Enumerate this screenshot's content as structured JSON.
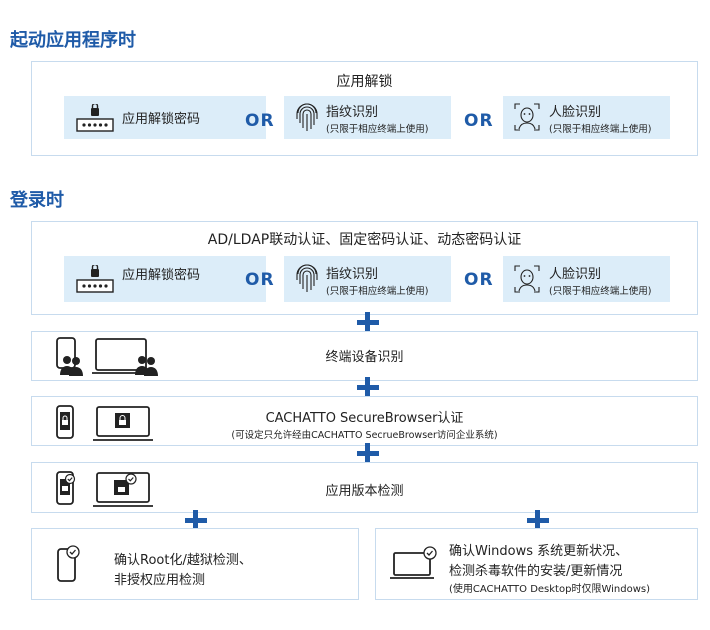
{
  "section1": {
    "heading": "起动应用程序时",
    "panel_title": "应用解锁",
    "chips": {
      "password": "应用解锁密码",
      "fingerprint": "指纹识别",
      "fingerprint_note": "(只限于相应终端上使用)",
      "face": "人脸识别",
      "face_note": "(只限于相应终端上使用)"
    },
    "or1": "OR",
    "or2": "OR"
  },
  "section2": {
    "heading": "登录时",
    "panel_title": "AD/LDAP联动认证、固定密码认证、动态密码认证",
    "chips": {
      "password": "应用解锁密码",
      "fingerprint": "指纹识别",
      "fingerprint_note": "(只限于相应终端上使用)",
      "face": "人脸识别",
      "face_note": "(只限于相应终端上使用)"
    },
    "or1": "OR",
    "or2": "OR"
  },
  "device_row": {
    "label": "终端设备识别"
  },
  "browser_row": {
    "label": "CACHATTO SecureBrowser认证",
    "note": "(可设定只允许经由CACHATTO SecrueBrowser访问企业系统)"
  },
  "version_row": {
    "label": "应用版本检测"
  },
  "bottom_left": {
    "line1": "确认Root化/越狱检测、",
    "line2": "非授权应用检测"
  },
  "bottom_right": {
    "line1": "确认Windows 系统更新状况、",
    "line2": "检测杀毒软件的安装/更新情况",
    "line3": "(使用CACHATTO Desktop时仅限Windows)"
  },
  "colors": {
    "accent": "#1f5ba8",
    "chip_bg": "#dcedf9",
    "border": "#c7dbee"
  }
}
